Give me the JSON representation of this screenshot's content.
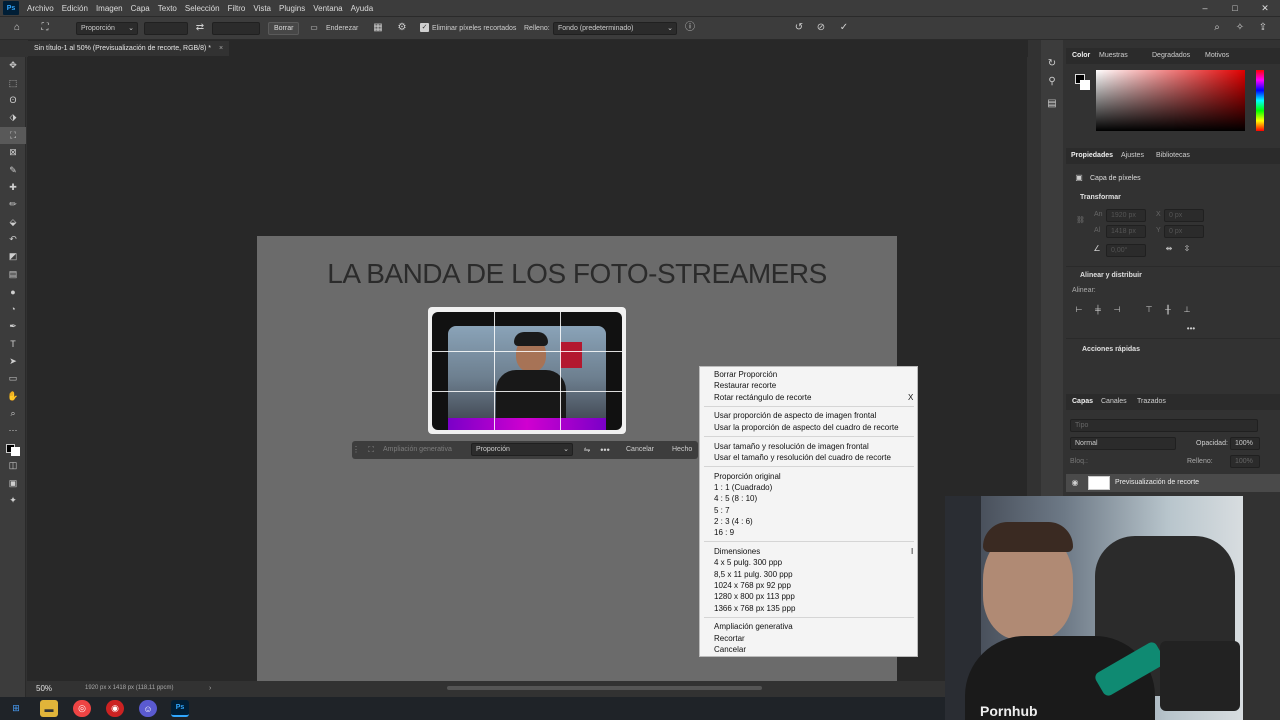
{
  "menubar": {
    "logo": "Ps",
    "items": [
      "Archivo",
      "Edición",
      "Imagen",
      "Capa",
      "Texto",
      "Selección",
      "Filtro",
      "Vista",
      "Plugins",
      "Ventana",
      "Ayuda"
    ]
  },
  "options": {
    "ratio_select": "Proporción",
    "clear_button": "Borrar",
    "straighten_label": "Enderezar",
    "delete_cropped_label": "Eliminar píxeles recortados",
    "fill_label": "Relleno:",
    "fill_value": "Fondo (predeterminado)"
  },
  "document_tab": {
    "title": "Sin título-1 al 50% (Previsualización de recorte, RGB/8) *",
    "close": "×"
  },
  "canvas": {
    "heading": "LA BANDA DE LOS FOTO-STREAMERS"
  },
  "task_bar": {
    "generative_expand": "Ampliación generativa",
    "ratio_select": "Proporción",
    "cancel": "Cancelar",
    "done": "Hecho"
  },
  "context_menu": {
    "group1": [
      "Borrar Proporción",
      "Restaurar recorte",
      "Rotar rectángulo de recorte"
    ],
    "rotate_shortcut": "X",
    "group2": [
      "Usar proporción de aspecto de imagen frontal",
      "Usar la proporción de aspecto del cuadro de recorte"
    ],
    "group3": [
      "Usar tamaño y resolución de imagen frontal",
      "Usar el tamaño y resolución del cuadro de recorte"
    ],
    "group4": [
      "Proporción original",
      "1 : 1 (Cuadrado)",
      "4 : 5 (8 : 10)",
      "5 : 7",
      "2 : 3 (4 : 6)",
      "16 : 9"
    ],
    "group5": [
      "Dimensiones",
      "4 x 5 pulg.  300 ppp",
      "8,5 x 11 pulg.  300 ppp",
      "1024 x 768 px  92 ppp",
      "1280 x 800 px  113 ppp",
      "1366 x 768 px  135 ppp"
    ],
    "dimensions_shortcut": "I",
    "group6": [
      "Ampliación generativa",
      "Recortar",
      "Cancelar"
    ]
  },
  "status": {
    "zoom": "50%",
    "doc_info": "1920 px x 1418 px (118,11 ppcm)",
    "arrow": "›"
  },
  "color_panel": {
    "tabs": [
      "Color",
      "Muestras",
      "Degradados",
      "Motivos"
    ]
  },
  "properties_panel": {
    "tabs": [
      "Propiedades",
      "Ajustes",
      "Bibliotecas"
    ],
    "layer_kind": "Capa de píxeles",
    "transform": "Transformar",
    "w_label": "An",
    "w_value": "1920 px",
    "h_label": "Al",
    "h_value": "1418 px",
    "x_label": "X",
    "x_value": "0 px",
    "y_label": "Y",
    "y_value": "0 px",
    "angle_value": "0,00°",
    "align_section": "Alinear y distribuir",
    "align_label": "Alinear:",
    "quick_actions": "Acciones rápidas"
  },
  "layers_panel": {
    "tabs": [
      "Capas",
      "Canales",
      "Trazados"
    ],
    "search_placeholder": "Tipo",
    "blend_mode": "Normal",
    "opacity_label": "Opacidad:",
    "opacity_value": "100%",
    "lock_label": "Bloq.:",
    "fill_label": "Relleno:",
    "fill_value": "100%",
    "layer_name": "Previsualización de recorte"
  },
  "webcam": {
    "shirt_text": "Pornhub"
  }
}
